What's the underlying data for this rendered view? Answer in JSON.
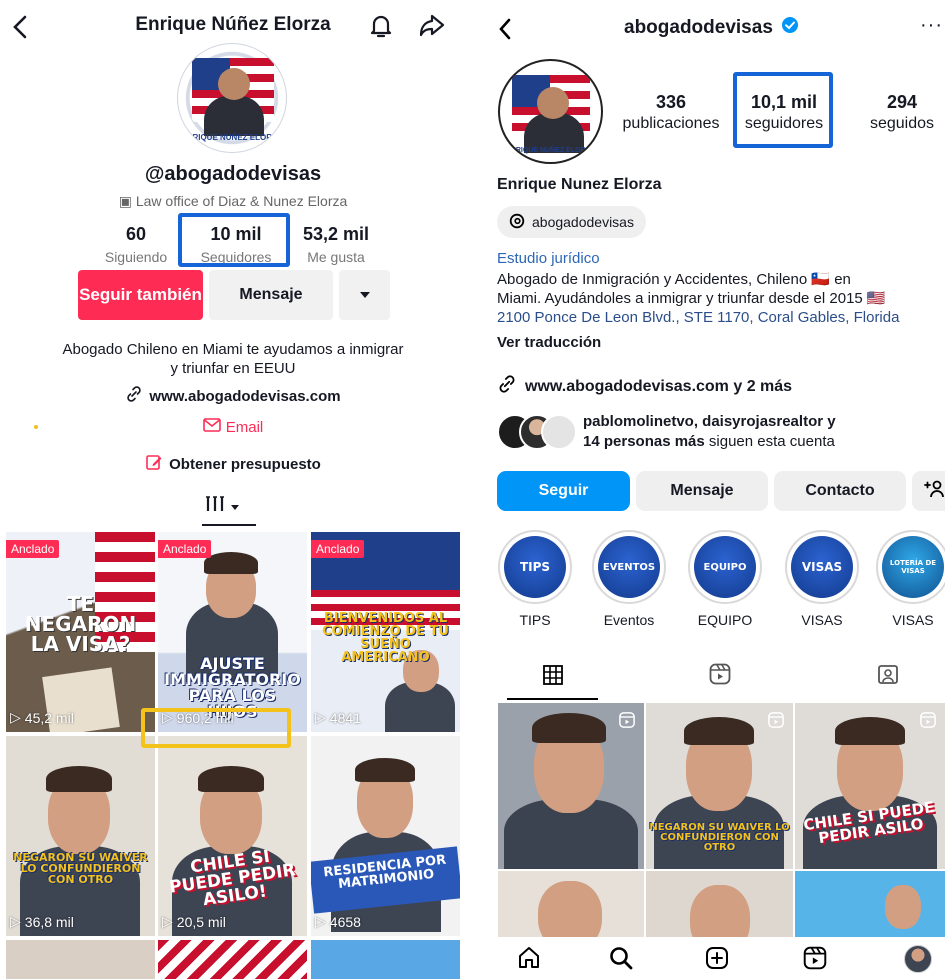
{
  "tiktok": {
    "title": "Enrique Núñez Elorza",
    "avatar_text": "ENRIQUE NUÑEZ ELORZA",
    "handle": "@abogadodevisas",
    "org": "Law office of Diaz & Nunez Elorza",
    "stats": [
      {
        "num": "60",
        "label": "Siguiendo"
      },
      {
        "num": "10 mil",
        "label": "Seguidores"
      },
      {
        "num": "53,2 mil",
        "label": "Me gusta"
      }
    ],
    "follow_label": "Seguir también",
    "message_label": "Mensaje",
    "bio_line1": "Abogado Chileno en Miami te ayudamos a inmigrar",
    "bio_line2": "y triunfar en EEUU",
    "website": "www.abogadodevisas.com",
    "email_label": "Email",
    "quote_label": "Obtener presupuesto",
    "videos": [
      {
        "pinned": "Anclado",
        "views": "45,2 mil",
        "caption": "TE NEGARON LA VISA?"
      },
      {
        "pinned": "Anclado",
        "views": "960,2 mil",
        "caption": "AJUSTE IMMIGRATORIO PARA LOS HIJOS"
      },
      {
        "pinned": "Anclado",
        "views": "4841",
        "caption": "BIENVENIDOS AL COMIENZO DE TU SUEÑO AMERICANO"
      },
      {
        "pinned": "",
        "views": "36,8 mil",
        "caption": "NEGARON SU WAIVER LO CONFUNDIERON CON OTRO"
      },
      {
        "pinned": "",
        "views": "20,5 mil",
        "caption": "CHILE SI PUEDE PEDIR ASILO!"
      },
      {
        "pinned": "",
        "views": "4658",
        "caption": "RESIDENCIA POR MATRIMONIO"
      }
    ]
  },
  "instagram": {
    "username": "abogadodevisas",
    "stats": [
      {
        "num": "336",
        "label": "publicaciones"
      },
      {
        "num": "10,1 mil",
        "label": "seguidores"
      },
      {
        "num": "294",
        "label": "seguidos"
      }
    ],
    "full_name": "Enrique Nunez Elorza",
    "threads_handle": "abogadodevisas",
    "category": "Estudio jurídico",
    "bio_line1": "Abogado de Inmigración y Accidentes, Chileno 🇨🇱 en",
    "bio_line2": "Miami. Ayudándoles a inmigrar y triunfar desde el 2015 🇺🇸",
    "address": "2100 Ponce De Leon Blvd., STE 1170, Coral Gables, Florida",
    "translate_label": "Ver traducción",
    "link_label": "www.abogadodevisas.com y 2 más",
    "followed_line1": "pablomolinetvo, daisyrojasrealtor y",
    "followed_bold": "14 personas más",
    "followed_rest": " siguen esta cuenta",
    "buttons": {
      "follow": "Seguir",
      "message": "Mensaje",
      "contact": "Contacto"
    },
    "highlights": [
      {
        "cover": "TIPS",
        "label": "TIPS"
      },
      {
        "cover": "EVENTOS",
        "label": "Eventos"
      },
      {
        "cover": "EQUIPO",
        "label": "EQUIPO"
      },
      {
        "cover": "VISAS",
        "label": "VISAS"
      },
      {
        "cover": "LOTERÍA DE VISAS",
        "label": "VISAS"
      }
    ],
    "posts": [
      {
        "caption": ""
      },
      {
        "caption": "NEGARON SU WAIVER LO CONFUNDIERON CON OTRO"
      },
      {
        "caption": "CHILE SI PUEDE PEDIR ASILO"
      }
    ]
  }
}
